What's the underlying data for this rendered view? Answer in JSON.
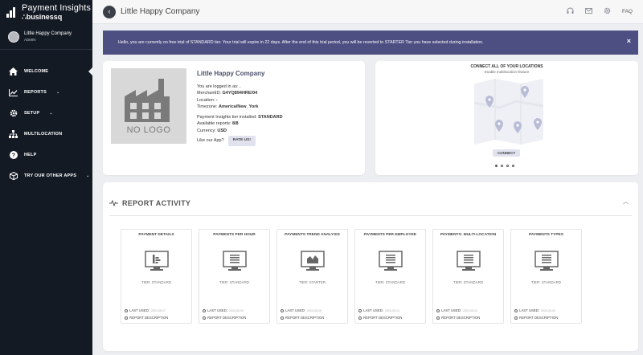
{
  "brand": {
    "title": "Payment Insights",
    "subtitle": "∴businessq"
  },
  "user": {
    "name": "Little Happy Company",
    "role": "ADMIN"
  },
  "nav": [
    {
      "label": "WELCOME",
      "icon": "home-icon",
      "has_submenu": false,
      "active": true
    },
    {
      "label": "REPORTS",
      "icon": "chart-line-icon",
      "has_submenu": true
    },
    {
      "label": "SETUP",
      "icon": "gear-icon",
      "has_submenu": true
    },
    {
      "label": "MULTILOCATION",
      "icon": "sitemap-icon",
      "has_submenu": false
    },
    {
      "label": "HELP",
      "icon": "help-icon",
      "has_submenu": false
    },
    {
      "label": "TRY OUR OTHER APPS",
      "icon": "cube-icon",
      "has_submenu": true
    }
  ],
  "header": {
    "company": "Little Happy Company",
    "faq": "FAQ",
    "icons": [
      "headset-icon",
      "mail-icon",
      "gear-icon"
    ]
  },
  "banner": {
    "text": "Hello, you are currently on free trial of STANDARD tier. Your trial will expire in 22 days. After the end of this trial period, you will be reverted to STARTER Tier you have selected during installation.",
    "close": "×"
  },
  "company_card": {
    "logo_text": "NO LOGO",
    "name": "Little Happy Company",
    "logged_in": "You are logged in as: ,",
    "merchant_label": "MerchantID:",
    "merchant_value": "G4YQ894HRE/04",
    "location_label": "Location:",
    "location_value": "-",
    "timezone_label": "Timezone:",
    "timezone_value": "America/New_York",
    "tier_label": "Payment Insights tier installed:",
    "tier_value": "STANDARD",
    "reports_label": "Available reports:",
    "reports_value": "8/8",
    "currency_label": "Currency:",
    "currency_value": "USD",
    "like_app": "Like our App?",
    "rate_button": "RATE US!"
  },
  "connect_card": {
    "title": "CONNECT ALL OF YOUR LOCATIONS",
    "subtitle": "Enable multilocation feature",
    "button": "CONNECT",
    "slide_count": 4,
    "active_slide": 1
  },
  "report_activity": {
    "title": "REPORT ACTIVITY",
    "last_used_label": "LAST USED:",
    "description_label": "REPORT DESCRIPTION",
    "tiles": [
      {
        "name": "PAYMENT DETAILS",
        "icon": "bar-chart-icon",
        "tier": "TIER: STANDARD",
        "date": "2023-05-07"
      },
      {
        "name": "PAYMENTS PER HOUR",
        "icon": "list-report-icon",
        "tier": "TIER: STANDARD",
        "date": "2023-05-09"
      },
      {
        "name": "PAYMENTS TREND ANALYSIS",
        "icon": "area-chart-icon",
        "tier": "TIER: STARTER",
        "date": "2023-05-09"
      },
      {
        "name": "PAYMENTS PER EMPLOYEE",
        "icon": "list-report-icon",
        "tier": "TIER: STANDARD",
        "date": "2023-05-10"
      },
      {
        "name": "PAYMENTS: MULTI-LOCATION",
        "icon": "list-report-icon",
        "tier": "TIER: STANDARD",
        "date": "2023-05-10"
      },
      {
        "name": "PAYMENTS TYPES",
        "icon": "list-report-icon",
        "tier": "TIER: STANDARD",
        "date": "2023-05-03"
      }
    ]
  }
}
